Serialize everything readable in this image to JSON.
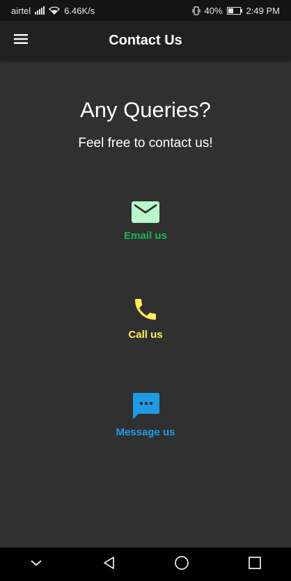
{
  "status_bar": {
    "carrier": "airtel",
    "network_speed": "6.46K/s",
    "battery_percent": "40%",
    "time": "2:49 PM"
  },
  "app_bar": {
    "title": "Contact Us",
    "menu_icon": "hamburger-menu-icon"
  },
  "main": {
    "heading": "Any Queries?",
    "subheading": "Feel free to contact us!",
    "options": [
      {
        "label": "Email us",
        "icon": "email-icon",
        "color": "#19b84f",
        "icon_color": "#b9f6ca"
      },
      {
        "label": "Call us",
        "icon": "phone-icon",
        "color": "#ffee58",
        "icon_color": "#ffee58"
      },
      {
        "label": "Message us",
        "icon": "message-icon",
        "color": "#1e9be4",
        "icon_color": "#1e9be4"
      }
    ]
  },
  "nav_bar": {
    "icons": [
      "chevron-down-icon",
      "back-icon",
      "home-icon",
      "recents-icon"
    ]
  },
  "colors": {
    "background": "#303030",
    "app_bar": "#212121",
    "status_bar": "#141414"
  }
}
